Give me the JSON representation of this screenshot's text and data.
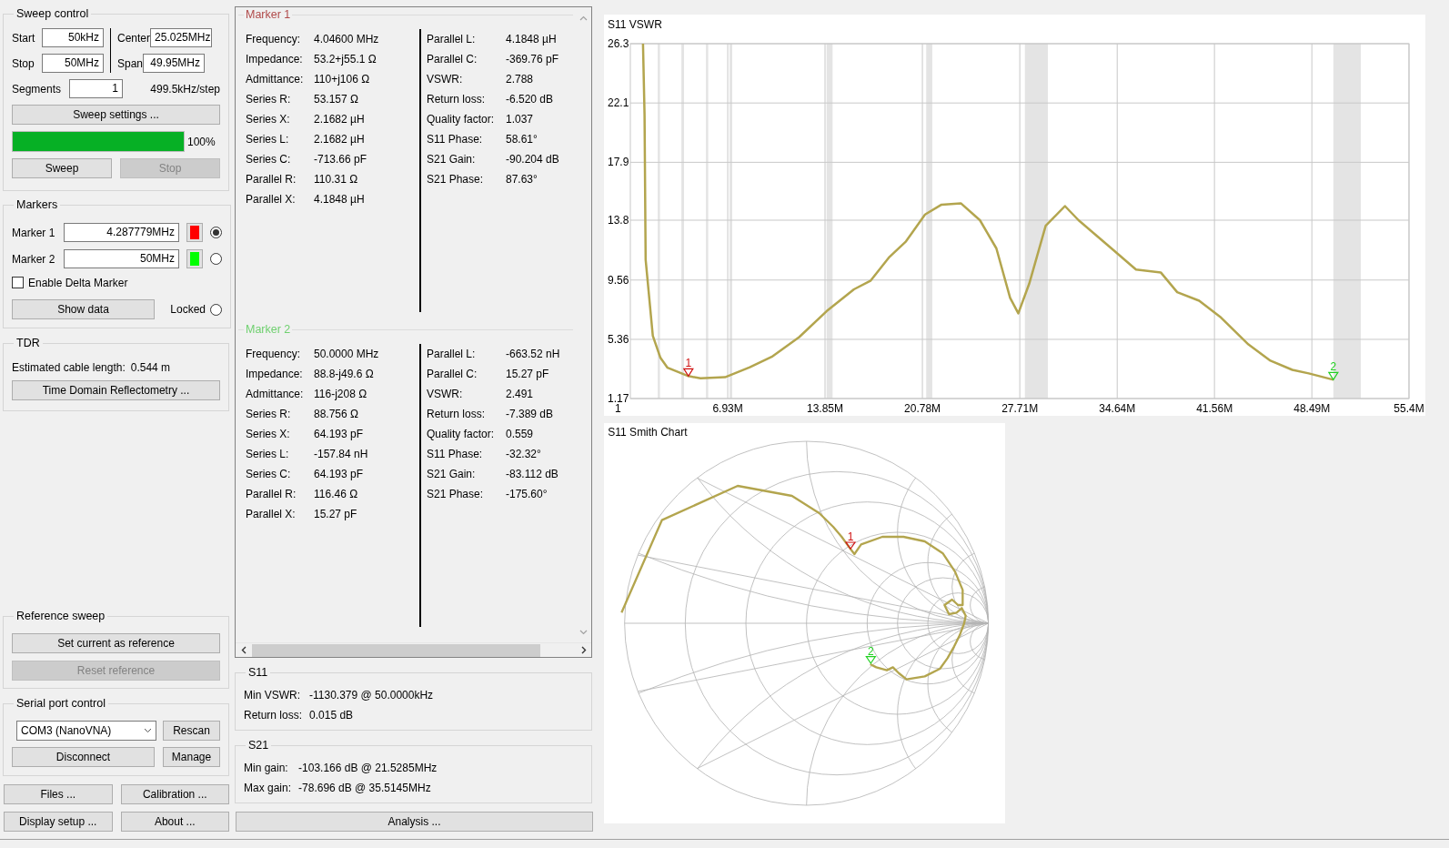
{
  "sweep_control": {
    "title": "Sweep control",
    "start": {
      "label": "Start",
      "value": "50kHz"
    },
    "stop": {
      "label": "Stop",
      "value": "50MHz"
    },
    "center": {
      "label": "Center",
      "value": "25.025MHz"
    },
    "span": {
      "label": "Span",
      "value": "49.95MHz"
    },
    "segments": {
      "label": "Segments",
      "value": "1"
    },
    "step": "499.5kHz/step",
    "settings_button": "Sweep settings ...",
    "progress": {
      "level": 1,
      "reading": "100%"
    },
    "buttons": [
      {
        "label": "Sweep",
        "disabled": false
      },
      {
        "label": "Stop",
        "disabled": true
      }
    ]
  },
  "markers": {
    "title": "Markers",
    "items": [
      {
        "label": "Marker 1",
        "frequency": "4.287779MHz",
        "color": "#ff0000",
        "selected": true
      },
      {
        "label": "Marker 2",
        "frequency": "50MHz",
        "color": "#00ff00",
        "selected": false
      }
    ],
    "delta_marker": {
      "label": "Enable Delta Marker",
      "checked": false
    },
    "show_data_button": "Show data",
    "locked": {
      "label": "Locked",
      "selected": false
    }
  },
  "tdr": {
    "title": "TDR",
    "cable_label": "Estimated cable length:",
    "cable_value": "0.544 m",
    "button": "Time Domain Reflectometry ..."
  },
  "reference_sweep": {
    "title": "Reference sweep",
    "buttons": [
      {
        "label": "Set current as reference",
        "disabled": false
      },
      {
        "label": "Reset reference",
        "disabled": true
      }
    ]
  },
  "serial_port": {
    "title": "Serial port control",
    "port": "COM3 (NanoVNA)",
    "rescan_button": "Rescan",
    "disconnect_button": "Disconnect",
    "manage_button": "Manage"
  },
  "bottom_buttons": [
    "Files ...",
    "Calibration ...",
    "Display setup ...",
    "About ..."
  ],
  "marker_details": [
    {
      "title": "Marker 1",
      "color": "#b04a4a",
      "left": [
        {
          "label": "Frequency:",
          "value": "4.04600 MHz"
        },
        {
          "label": "Impedance:",
          "value": "53.2+j55.1 Ω"
        },
        {
          "label": "Admittance:",
          "value": "110+j106 Ω"
        },
        {
          "label": "Series R:",
          "value": "53.157 Ω"
        },
        {
          "label": "Series X:",
          "value": "2.1682 µH"
        },
        {
          "label": "Series L:",
          "value": "2.1682 µH"
        },
        {
          "label": "Series C:",
          "value": "-713.66 pF"
        },
        {
          "label": "Parallel R:",
          "value": "110.31 Ω"
        },
        {
          "label": "Parallel X:",
          "value": "4.1848 µH"
        }
      ],
      "right": [
        {
          "label": "Parallel L:",
          "value": "4.1848 µH"
        },
        {
          "label": "Parallel C:",
          "value": "-369.76 pF"
        },
        {
          "label": "VSWR:",
          "value": "2.788"
        },
        {
          "label": "Return loss:",
          "value": "-6.520 dB"
        },
        {
          "label": "Quality factor:",
          "value": "1.037"
        },
        {
          "label": "S11 Phase:",
          "value": "58.61°"
        },
        {
          "label": "S21 Gain:",
          "value": "-90.204 dB"
        },
        {
          "label": "S21 Phase:",
          "value": "87.63°"
        }
      ]
    },
    {
      "title": "Marker 2",
      "color": "#6fd06f",
      "left": [
        {
          "label": "Frequency:",
          "value": "50.0000 MHz"
        },
        {
          "label": "Impedance:",
          "value": "88.8-j49.6 Ω"
        },
        {
          "label": "Admittance:",
          "value": "116-j208 Ω"
        },
        {
          "label": "Series R:",
          "value": "88.756 Ω"
        },
        {
          "label": "Series X:",
          "value": "64.193 pF"
        },
        {
          "label": "Series L:",
          "value": "-157.84 nH"
        },
        {
          "label": "Series C:",
          "value": "64.193 pF"
        },
        {
          "label": "Parallel R:",
          "value": "116.46 Ω"
        },
        {
          "label": "Parallel X:",
          "value": "15.27 pF"
        }
      ],
      "right": [
        {
          "label": "Parallel L:",
          "value": "-663.52 nH"
        },
        {
          "label": "Parallel C:",
          "value": "15.27 pF"
        },
        {
          "label": "VSWR:",
          "value": "2.491"
        },
        {
          "label": "Return loss:",
          "value": "-7.389 dB"
        },
        {
          "label": "Quality factor:",
          "value": "0.559"
        },
        {
          "label": "S11 Phase:",
          "value": "-32.32°"
        },
        {
          "label": "S21 Gain:",
          "value": "-83.112 dB"
        },
        {
          "label": "S21 Phase:",
          "value": "-175.60°"
        }
      ]
    }
  ],
  "s11": {
    "title": "S11",
    "rows": [
      {
        "label": "Min VSWR:",
        "value": "-1130.379 @ 50.0000kHz"
      },
      {
        "label": "Return loss:",
        "value": "0.015 dB"
      }
    ]
  },
  "s21": {
    "title": "S21",
    "rows": [
      {
        "label": "Min gain:",
        "value": "-103.166 dB @ 21.5285MHz"
      },
      {
        "label": "Max gain:",
        "value": "-78.696 dB @ 35.5145MHz"
      }
    ]
  },
  "analysis_button": "Analysis ...",
  "vswr_chart": {
    "chart_data": {
      "type": "line",
      "title": "S11 VSWR",
      "x": [
        0.9,
        1.01,
        1.09,
        1.6,
        2.14,
        2.65,
        4.13,
        4.99,
        6.74,
        8.5,
        10.06,
        12.01,
        13.96,
        15.91,
        17.08,
        18.44,
        19.61,
        20.97,
        22.14,
        23.51,
        24.87,
        26.04,
        27.02,
        27.6,
        28.38,
        29.55,
        30.92,
        31.89,
        33.06,
        34.23,
        35.98,
        37.74,
        38.91,
        40.47,
        42.03,
        43.98,
        45.54,
        47.1,
        48.27,
        50.02
      ],
      "series": [
        {
          "color": "#b3a54e",
          "values": [
            26.3,
            21.3,
            11.0,
            5.6,
            4.05,
            3.35,
            2.76,
            2.6,
            2.68,
            3.38,
            4.12,
            5.52,
            7.35,
            8.9,
            9.5,
            11.2,
            12.3,
            14.2,
            14.9,
            15.0,
            13.8,
            11.8,
            8.3,
            7.2,
            9.3,
            13.4,
            14.8,
            13.8,
            12.8,
            11.8,
            10.3,
            10.1,
            8.7,
            8.1,
            6.9,
            5.0,
            3.85,
            3.2,
            2.95,
            2.5
          ]
        }
      ],
      "xlim": [
        0,
        55.4
      ],
      "ylim": [
        1.17,
        26.3
      ],
      "xticks": [
        {
          "value": 6.93,
          "label": "6.93M"
        },
        {
          "value": 13.85,
          "label": "13.85M"
        },
        {
          "value": 20.78,
          "label": "20.78M"
        },
        {
          "value": 27.71,
          "label": "27.71M"
        },
        {
          "value": 34.64,
          "label": "34.64M"
        },
        {
          "value": 41.56,
          "label": "41.56M"
        },
        {
          "value": 48.49,
          "label": "48.49M"
        },
        {
          "value": 55.4,
          "label": "55.4M"
        }
      ],
      "yticks": [
        1.17,
        5.36,
        9.56,
        13.8,
        17.9,
        22.1,
        26.3
      ],
      "grid": true,
      "annotations": [
        {
          "text": "1",
          "x": 4.13,
          "y": 2.76
        },
        {
          "text": "2",
          "x": 50.02,
          "y": 2.5
        }
      ]
    },
    "x_start_label": "1"
  },
  "smith_chart": {
    "title": "S11 Smith Chart",
    "markers": [
      {
        "label": "1",
        "color": "#d01010"
      },
      {
        "label": "2",
        "color": "#20d020"
      }
    ]
  }
}
